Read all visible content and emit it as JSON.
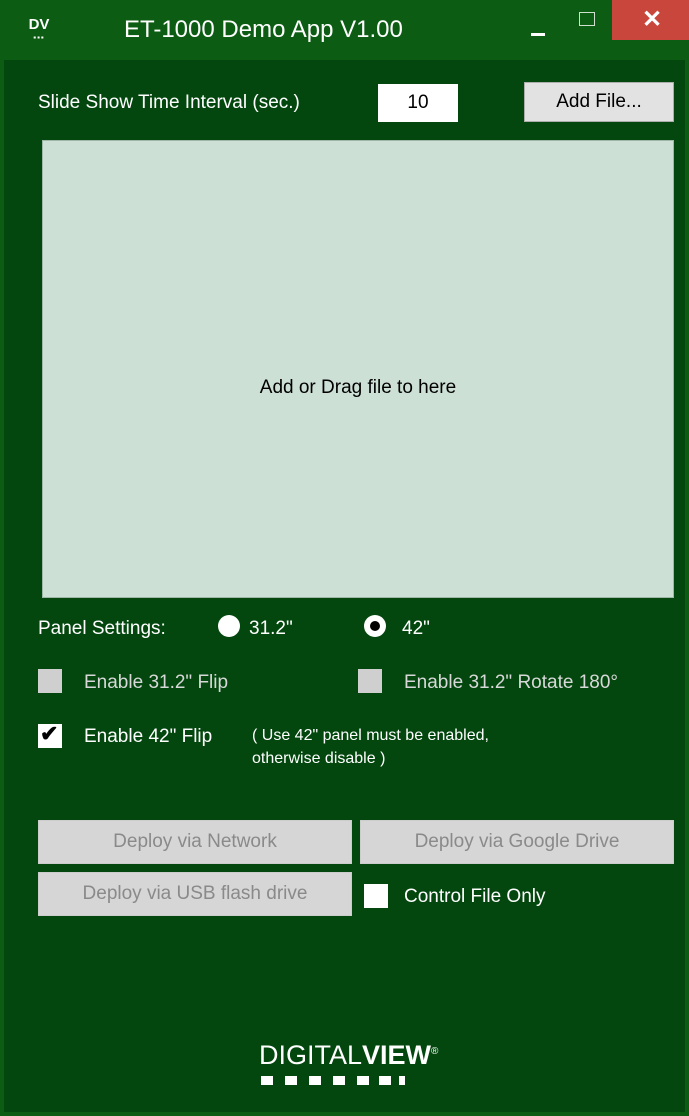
{
  "window": {
    "title": "ET-1000 Demo App V1.00",
    "icon_text": "DV",
    "close_glyph": "✕"
  },
  "slideshow": {
    "label": "Slide Show Time Interval (sec.)",
    "interval_value": "10",
    "add_file_label": "Add File..."
  },
  "dropzone": {
    "text": "Add or Drag file to here"
  },
  "panel_settings": {
    "label": "Panel Settings:",
    "options": [
      {
        "label": "31.2\"",
        "selected": false
      },
      {
        "label": "42\"",
        "selected": true
      }
    ]
  },
  "checkboxes": {
    "flip_31": {
      "label": "Enable 31.2\" Flip",
      "checked": false,
      "enabled": false
    },
    "rotate_31": {
      "label": "Enable 31.2\" Rotate 180°",
      "checked": false,
      "enabled": false
    },
    "flip_42": {
      "label": "Enable 42\" Flip",
      "checked": true,
      "enabled": true
    },
    "flip_42_note_line1": "( Use 42\" panel must be enabled,",
    "flip_42_note_line2": "otherwise disable )",
    "control_file_only": {
      "label": "Control File Only",
      "checked": false,
      "enabled": true
    }
  },
  "deploy": {
    "network": "Deploy via Network",
    "google_drive": "Deploy via Google Drive",
    "usb": "Deploy via USB flash drive"
  },
  "logo": {
    "text_light": "DIGITAL",
    "text_bold": "VIEW",
    "mark": "®"
  },
  "colors": {
    "background": "#03470e",
    "titlebar": "#0c5d13",
    "dropzone": "#cce0d6",
    "close_button": "#c9463d"
  }
}
